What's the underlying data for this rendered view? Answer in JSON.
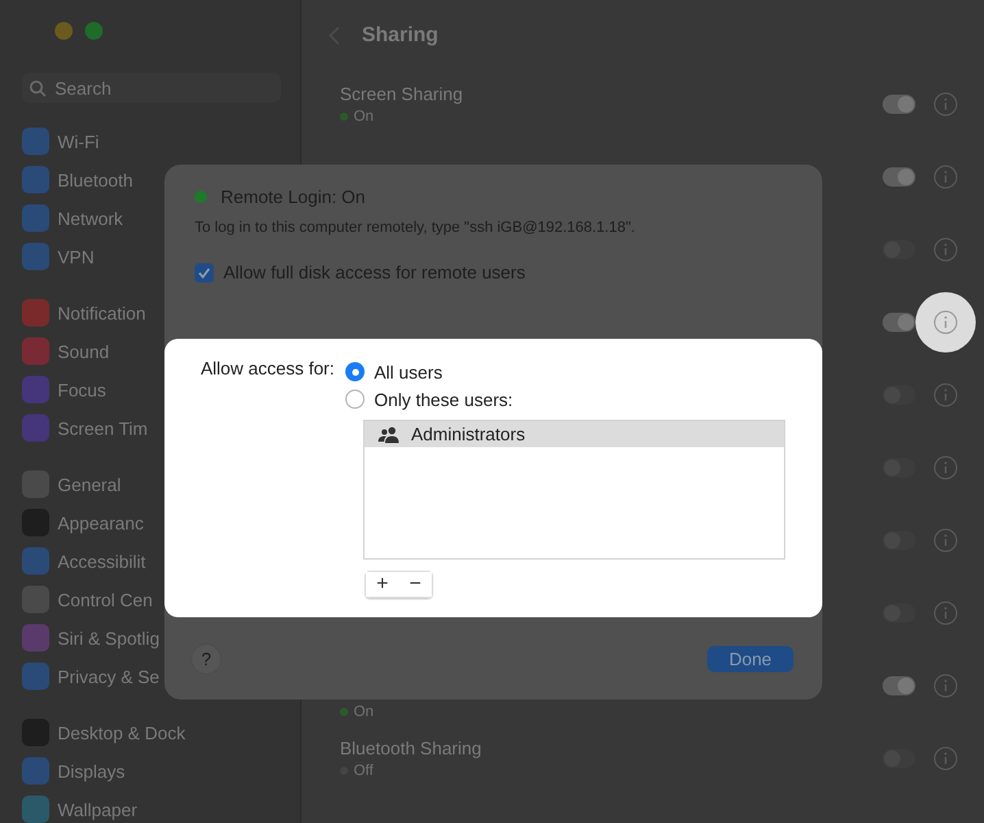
{
  "sidebar": {
    "search": {
      "placeholder": "Search"
    },
    "groups": [
      [
        {
          "label": "Wi-Fi",
          "color": "#2a4a78"
        },
        {
          "label": "Bluetooth",
          "color": "#2a4a78"
        },
        {
          "label": "Network",
          "color": "#2a4a78"
        },
        {
          "label": "VPN",
          "color": "#2a4a78"
        }
      ],
      [
        {
          "label": "Notification",
          "color": "#7a2a2a"
        },
        {
          "label": "Sound",
          "color": "#7a2a35"
        },
        {
          "label": "Focus",
          "color": "#45357a"
        },
        {
          "label": "Screen Tim",
          "color": "#45357a"
        }
      ],
      [
        {
          "label": "General",
          "color": "#4a4a4a"
        },
        {
          "label": "Appearanc",
          "color": "#1e1e1e"
        },
        {
          "label": "Accessibilit",
          "color": "#2a4a78"
        },
        {
          "label": "Control Cen",
          "color": "#4a4a4a"
        },
        {
          "label": "Siri & Spotlig",
          "color": "#5a3a6a"
        },
        {
          "label": "Privacy & Se",
          "color": "#2a4a78"
        }
      ],
      [
        {
          "label": "Desktop & Dock",
          "color": "#1e1e1e"
        },
        {
          "label": "Displays",
          "color": "#2a4a78"
        },
        {
          "label": "Wallpaper",
          "color": "#2a5a6a"
        }
      ]
    ]
  },
  "content": {
    "title": "Sharing",
    "rows": [
      {
        "title": "Screen Sharing",
        "status": "On",
        "on": true,
        "highlighted": false
      },
      {
        "on": true,
        "highlighted": false
      },
      {
        "on": false,
        "highlighted": false
      },
      {
        "on": true,
        "highlighted": true
      },
      {
        "on": false,
        "highlighted": false
      },
      {
        "on": false,
        "highlighted": false
      },
      {
        "on": false,
        "highlighted": false
      },
      {
        "on": false,
        "highlighted": false
      },
      {
        "status": "On",
        "on": true,
        "highlighted": false
      },
      {
        "title": "Bluetooth Sharing",
        "status": "Off",
        "on": false,
        "highlighted": false
      }
    ]
  },
  "dialog": {
    "status": {
      "label": "Remote Login: On",
      "on": true
    },
    "description": "To log in to this computer remotely, type \"ssh iGB@192.168.1.18\".",
    "full_disk_access": {
      "label": "Allow full disk access for remote users",
      "checked": true
    },
    "access_label": "Allow access for:",
    "access_options": [
      {
        "label": "All users",
        "selected": true
      },
      {
        "label": "Only these users:",
        "selected": false
      }
    ],
    "users": [
      {
        "name": "Administrators",
        "selected": true
      }
    ],
    "list_buttons": [
      "+",
      "−"
    ],
    "help": "?",
    "done": "Done"
  }
}
